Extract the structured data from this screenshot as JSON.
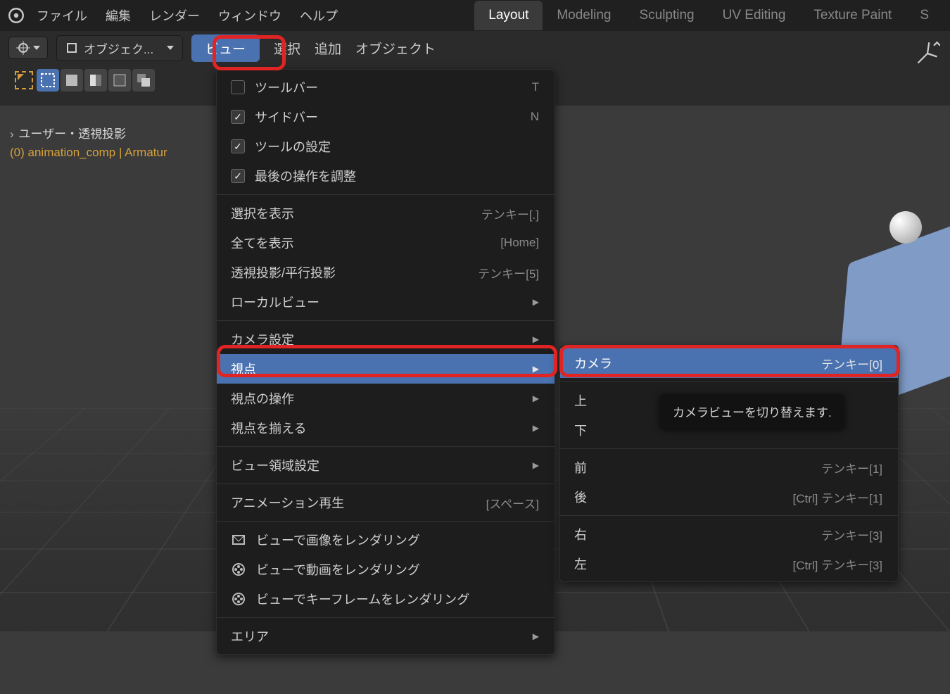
{
  "topbar": {
    "file_menu": [
      "ファイル",
      "編集",
      "レンダー",
      "ウィンドウ",
      "ヘルプ"
    ],
    "workspaces": [
      "Layout",
      "Modeling",
      "Sculpting",
      "UV Editing",
      "Texture Paint",
      "S"
    ],
    "active_workspace": 0
  },
  "hdr2": {
    "mode_label": "オブジェク...",
    "view": "ビュー",
    "menus": [
      "選択",
      "追加",
      "オブジェクト"
    ]
  },
  "vp": {
    "line1": "ユーザー・透視投影",
    "line2_prefix": "(0)",
    "line2_rest": " animation_comp | Armatur"
  },
  "view_menu": {
    "sec1": [
      {
        "checked": false,
        "label": "ツールバー",
        "shortcut": "T"
      },
      {
        "checked": true,
        "label": "サイドバー",
        "shortcut": "N"
      },
      {
        "checked": true,
        "label": "ツールの設定",
        "shortcut": ""
      },
      {
        "checked": true,
        "label": "最後の操作を調整",
        "shortcut": ""
      }
    ],
    "sec2": [
      {
        "label": "選択を表示",
        "shortcut": "テンキー[.]"
      },
      {
        "label": "全てを表示",
        "shortcut": "[Home]"
      },
      {
        "label": "透視投影/平行投影",
        "shortcut": "テンキー[5]"
      },
      {
        "label": "ローカルビュー",
        "shortcut": "",
        "submenu": true
      }
    ],
    "sec3": [
      {
        "label": "カメラ設定",
        "submenu": true
      },
      {
        "label": "視点",
        "submenu": true,
        "hl": true
      },
      {
        "label": "視点の操作",
        "submenu": true
      },
      {
        "label": "視点を揃える",
        "submenu": true
      }
    ],
    "sec4": [
      {
        "label": "ビュー領域設定",
        "submenu": true
      }
    ],
    "sec5": [
      {
        "label": "アニメーション再生",
        "shortcut": "[スペース]"
      }
    ],
    "sec6": [
      {
        "icon": "render-image-icon",
        "label": "ビューで画像をレンダリング"
      },
      {
        "icon": "render-video-icon",
        "label": "ビューで動画をレンダリング"
      },
      {
        "icon": "render-video-icon",
        "label": "ビューでキーフレームをレンダリング"
      }
    ],
    "sec7": [
      {
        "label": "エリア",
        "submenu": true
      }
    ]
  },
  "viewpoint_submenu": {
    "rows": [
      {
        "label": "カメラ",
        "shortcut": "テンキー[0]",
        "hl": true
      },
      {
        "sep": true
      },
      {
        "label": "上",
        "shortcut": ""
      },
      {
        "label": "下",
        "shortcut": ""
      },
      {
        "sep": true
      },
      {
        "label": "前",
        "shortcut": "テンキー[1]"
      },
      {
        "label": "後",
        "shortcut": "[Ctrl] テンキー[1]"
      },
      {
        "sep": true
      },
      {
        "label": "右",
        "shortcut": "テンキー[3]"
      },
      {
        "label": "左",
        "shortcut": "[Ctrl] テンキー[3]"
      }
    ]
  },
  "tooltip": {
    "text": "カメラビューを切り替えます."
  }
}
